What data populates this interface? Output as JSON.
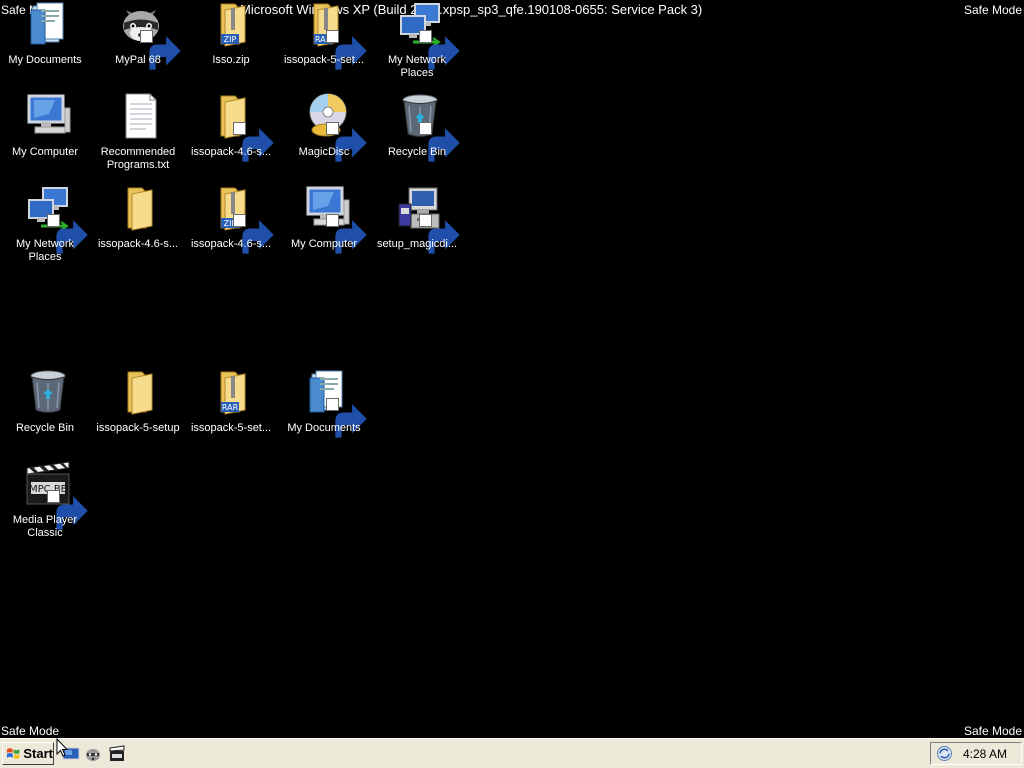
{
  "desktop": {
    "safe_mode": "Safe Mode",
    "build_banner": "Microsoft Windows XP (Build 2600.xpsp_sp3_qfe.190108-0655: Service Pack 3)",
    "icons": [
      {
        "label": "My Documents",
        "icon": "my-documents-icon"
      },
      {
        "label": "MyPal 68",
        "icon": "raccoon-icon"
      },
      {
        "label": "Isso.zip",
        "icon": "zip-folder-icon"
      },
      {
        "label": "issopack-5-set...",
        "icon": "rar-folder-icon"
      },
      {
        "label": "My Network Places",
        "icon": "network-places-icon"
      },
      {
        "label": "My Computer",
        "icon": "my-computer-icon"
      },
      {
        "label": "Recommended Programs.txt",
        "icon": "text-file-icon"
      },
      {
        "label": "issopack-4.6-s...",
        "icon": "folder-icon"
      },
      {
        "label": "MagicDisc",
        "icon": "cd-icon"
      },
      {
        "label": "Recycle Bin",
        "icon": "recycle-bin-icon"
      },
      {
        "label": "My Network Places",
        "icon": "network-places-icon"
      },
      {
        "label": "issopack-4.6-s...",
        "icon": "folder-icon"
      },
      {
        "label": "issopack-4.6-s...",
        "icon": "zip-folder-icon"
      },
      {
        "label": "My Computer",
        "icon": "my-computer-icon"
      },
      {
        "label": "setup_magicdi...",
        "icon": "setup-icon"
      },
      {
        "label": "Recycle Bin",
        "icon": "recycle-bin-icon"
      },
      {
        "label": "issopack-5-setup",
        "icon": "folder-icon"
      },
      {
        "label": "issopack-5-set...",
        "icon": "rar-folder-icon"
      },
      {
        "label": "My Documents",
        "icon": "my-documents-icon"
      },
      {
        "label": "Media Player Classic",
        "icon": "media-player-icon"
      }
    ]
  },
  "taskbar": {
    "start_label": "Start",
    "quick_launch": [
      "show-desktop-icon",
      "raccoon-icon",
      "media-player-icon"
    ],
    "clock": "4:28 AM",
    "tray_icon": "sync-icon"
  }
}
